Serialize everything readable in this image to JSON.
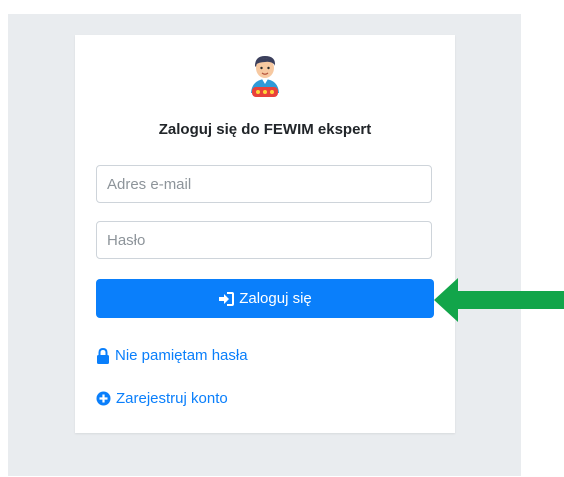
{
  "login": {
    "title": "Zaloguj się do FEWIM ekspert",
    "email_placeholder": "Adres e-mail",
    "password_placeholder": "Hasło",
    "submit_label": "Zaloguj się",
    "forgot_label": "Nie pamiętam hasła",
    "register_label": "Zarejestruj konto"
  },
  "icons": {
    "avatar": "expert-avatar-icon",
    "submit": "sign-in-icon",
    "forgot": "lock-icon",
    "register": "plus-circle-icon",
    "annotation": "green-arrow-icon"
  },
  "colors": {
    "primary": "#0a7ffb",
    "background": "#e9ecef",
    "annotation": "#12a54a"
  }
}
